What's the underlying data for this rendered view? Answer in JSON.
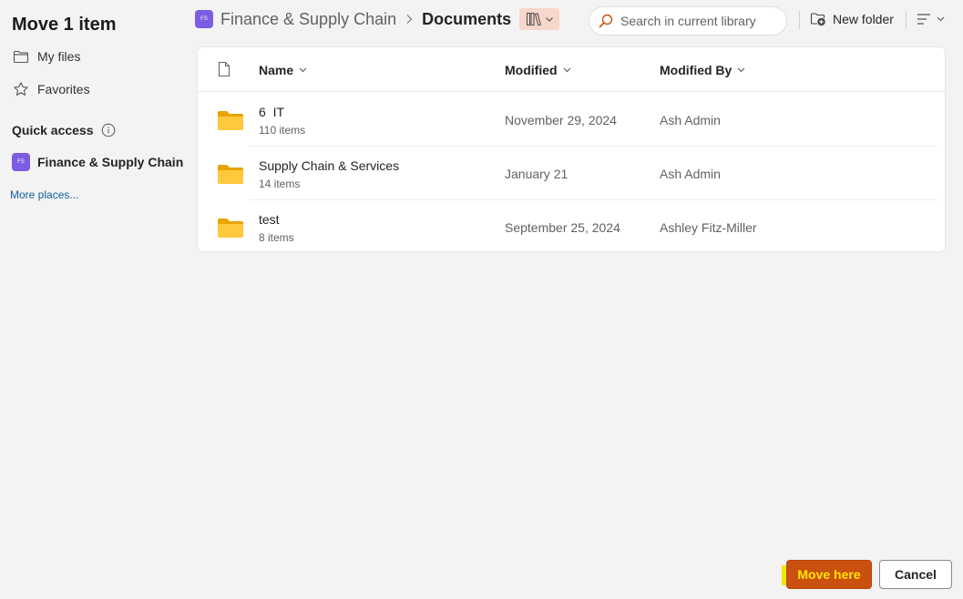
{
  "dialog": {
    "title": "Move 1 item"
  },
  "nav": {
    "my_files": {
      "label": "My files",
      "icon": "folder-icon"
    },
    "favorites": {
      "label": "Favorites",
      "icon": "star-icon"
    }
  },
  "quick_access": {
    "title": "Quick access",
    "site": {
      "label": "Finance & Supply Chain",
      "badge": "FS"
    },
    "more_places": "More places..."
  },
  "breadcrumb": {
    "site_badge": "FS",
    "site": "Finance & Supply Chain",
    "current": "Documents"
  },
  "search": {
    "placeholder": "Search in current library",
    "value": ""
  },
  "toolbar": {
    "new_folder": "New folder"
  },
  "columns": {
    "name": "Name",
    "modified": "Modified",
    "modified_by": "Modified By"
  },
  "rows": [
    {
      "name": "6  IT",
      "count": "110 items",
      "modified": "November 29, 2024",
      "modified_by": "Ash Admin"
    },
    {
      "name": "Supply Chain & Services",
      "count": "14 items",
      "modified": "January 21",
      "modified_by": "Ash Admin"
    },
    {
      "name": "test",
      "count": "8 items",
      "modified": "September 25, 2024",
      "modified_by": "Ashley Fitz-Miller"
    }
  ],
  "footer": {
    "primary": "Move here",
    "secondary": "Cancel"
  },
  "colors": {
    "accent": "#ca5010",
    "accent_text": "#ffe600",
    "site_badge": "#7b5ce3",
    "link": "#115ea3",
    "folder": "#f5b800"
  }
}
